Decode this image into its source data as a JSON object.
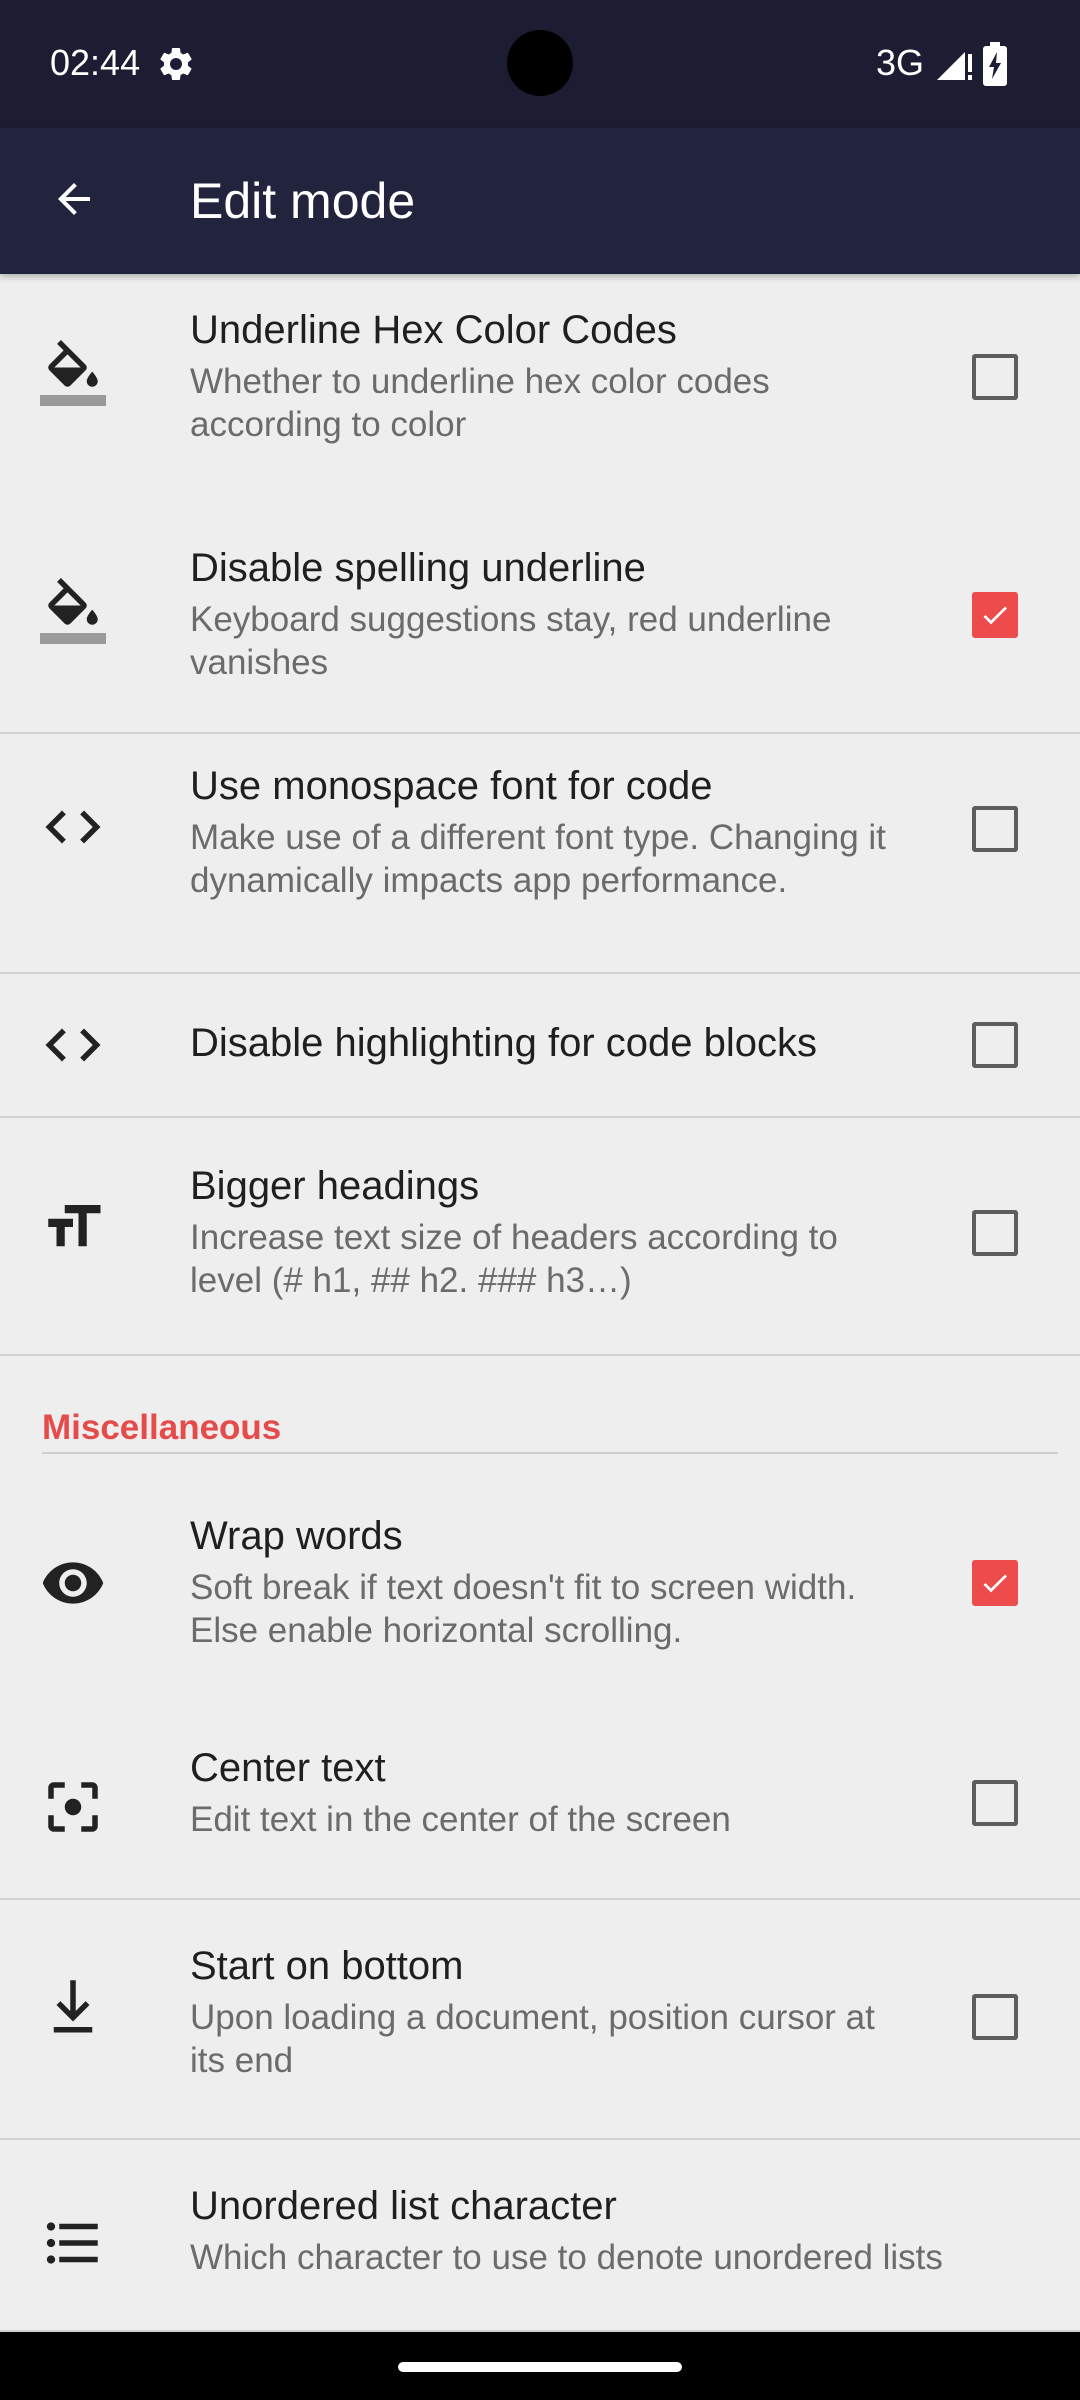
{
  "status_bar": {
    "time": "02:44",
    "network": "3G",
    "icons": [
      "gear-icon",
      "signal-icon",
      "battery-charging-icon"
    ]
  },
  "app_bar": {
    "title": "Edit mode",
    "back_icon": "arrow-back-icon"
  },
  "colors": {
    "accent": "#ee4b4d",
    "section_header": "#e54b4b",
    "app_bar": "#22243e",
    "status_bar": "#1c1d33",
    "background": "#eeeeee"
  },
  "items": [
    {
      "icon": "format-color-fill-icon",
      "title": "Underline Hex Color Codes",
      "summary": "Whether to underline hex color codes according to color",
      "checked": false
    },
    {
      "icon": "format-color-fill-icon",
      "title": "Disable spelling underline",
      "summary": "Keyboard suggestions stay, red underline vanishes",
      "checked": true
    },
    {
      "icon": "code-icon",
      "title": "Use monospace font for code",
      "summary": "Make use of a different font type. Changing it dynamically impacts app performance.",
      "checked": false
    },
    {
      "icon": "code-icon",
      "title": "Disable highlighting for code blocks",
      "summary": "",
      "checked": false
    },
    {
      "icon": "text-size-icon",
      "title": "Bigger headings",
      "summary": "Increase text size of headers according to level (# h1, ## h2. ### h3…)",
      "checked": false
    },
    {
      "icon": "eye-icon",
      "title": "Wrap words",
      "summary": "Soft break if text doesn't fit to screen width. Else enable horizontal scrolling.",
      "checked": true
    },
    {
      "icon": "center-focus-icon",
      "title": "Center text",
      "summary": "Edit text in the center of the screen",
      "checked": false
    },
    {
      "icon": "download-icon",
      "title": "Start on bottom",
      "summary": "Upon loading a document, position cursor at its end",
      "checked": false
    },
    {
      "icon": "list-bulleted-icon",
      "title": "Unordered list character",
      "summary": "Which character to use to denote unordered lists"
    }
  ],
  "section": {
    "misc_title": "Miscellaneous"
  }
}
